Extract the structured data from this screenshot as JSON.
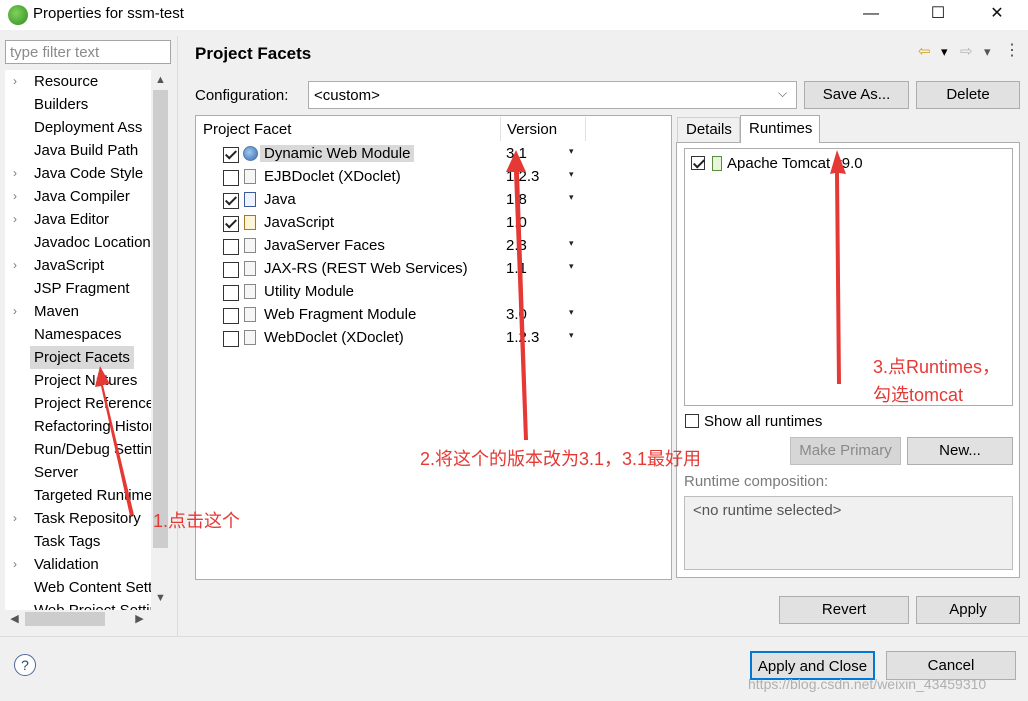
{
  "window": {
    "title": "Properties for ssm-test",
    "minimize_glyph": "—",
    "maximize_glyph": "☐",
    "close_glyph": "✕",
    "app_icon": "eclipse-icon"
  },
  "filter": {
    "placeholder": "type filter text"
  },
  "nav": {
    "items": [
      {
        "label": "Resource",
        "expandable": true
      },
      {
        "label": "Builders",
        "expandable": false
      },
      {
        "label": "Deployment Ass",
        "expandable": false
      },
      {
        "label": "Java Build Path",
        "expandable": false
      },
      {
        "label": "Java Code Style",
        "expandable": true
      },
      {
        "label": "Java Compiler",
        "expandable": true
      },
      {
        "label": "Java Editor",
        "expandable": true
      },
      {
        "label": "Javadoc Location",
        "expandable": false
      },
      {
        "label": "JavaScript",
        "expandable": true
      },
      {
        "label": "JSP Fragment",
        "expandable": false
      },
      {
        "label": "Maven",
        "expandable": true
      },
      {
        "label": "Namespaces",
        "expandable": false
      },
      {
        "label": "Project Facets",
        "expandable": false,
        "selected": true
      },
      {
        "label": "Project Natures",
        "expandable": false
      },
      {
        "label": "Project References",
        "expandable": false
      },
      {
        "label": "Refactoring History",
        "expandable": false
      },
      {
        "label": "Run/Debug Settings",
        "expandable": false
      },
      {
        "label": "Server",
        "expandable": false
      },
      {
        "label": "Targeted Runtimes",
        "expandable": false
      },
      {
        "label": "Task Repository",
        "expandable": true
      },
      {
        "label": "Task Tags",
        "expandable": false
      },
      {
        "label": "Validation",
        "expandable": true
      },
      {
        "label": "Web Content Settings",
        "expandable": false
      },
      {
        "label": "Web Project Settings",
        "expandable": false
      }
    ]
  },
  "page": {
    "heading": "Project Facets",
    "back_glyph": "⇦",
    "forward_glyph": "⇨",
    "dropdown_glyph": "▾"
  },
  "config": {
    "label": "Configuration:",
    "value": "<custom>",
    "save_as": "Save As...",
    "delete": "Delete"
  },
  "facets": {
    "columns": [
      "Project Facet",
      "Version"
    ],
    "rows": [
      {
        "name": "Dynamic Web Module",
        "version": "3.1",
        "checked": true,
        "dropdown": true,
        "selected": true,
        "icon": "web-module-icon"
      },
      {
        "name": "EJBDoclet (XDoclet)",
        "version": "1.2.3",
        "checked": false,
        "dropdown": true,
        "icon": "page-icon"
      },
      {
        "name": "Java",
        "version": "1.8",
        "checked": true,
        "dropdown": true,
        "icon": "java-icon"
      },
      {
        "name": "JavaScript",
        "version": "1.0",
        "checked": true,
        "dropdown": false,
        "icon": "javascript-icon"
      },
      {
        "name": "JavaServer Faces",
        "version": "2.3",
        "checked": false,
        "dropdown": true,
        "icon": "page-icon"
      },
      {
        "name": "JAX-RS (REST Web Services)",
        "version": "1.1",
        "checked": false,
        "dropdown": true,
        "icon": "page-icon"
      },
      {
        "name": "Utility Module",
        "version": "",
        "checked": false,
        "dropdown": false,
        "icon": "page-icon"
      },
      {
        "name": "Web Fragment Module",
        "version": "3.0",
        "checked": false,
        "dropdown": true,
        "icon": "page-icon"
      },
      {
        "name": "WebDoclet (XDoclet)",
        "version": "1.2.3",
        "checked": false,
        "dropdown": true,
        "icon": "page-icon"
      }
    ]
  },
  "tabs": {
    "details": "Details",
    "runtimes": "Runtimes"
  },
  "runtimes": {
    "items": [
      {
        "name": "Apache Tomcat v9.0",
        "checked": true
      }
    ],
    "show_all": "Show all runtimes",
    "make_primary": "Make Primary",
    "new": "New...",
    "composition_label": "Runtime composition:",
    "composition_value": "<no runtime selected>"
  },
  "buttons": {
    "revert": "Revert",
    "apply": "Apply",
    "apply_close": "Apply and Close",
    "cancel": "Cancel"
  },
  "annotations": {
    "step1": "1.点击这个",
    "step2": "2.将这个的版本改为3.1，3.1最好用",
    "step3_line1": "3.点Runtimes，",
    "step3_line2": "勾选tomcat",
    "color": "#e53935"
  },
  "watermark": "https://blog.csdn.net/weixin_43459310"
}
